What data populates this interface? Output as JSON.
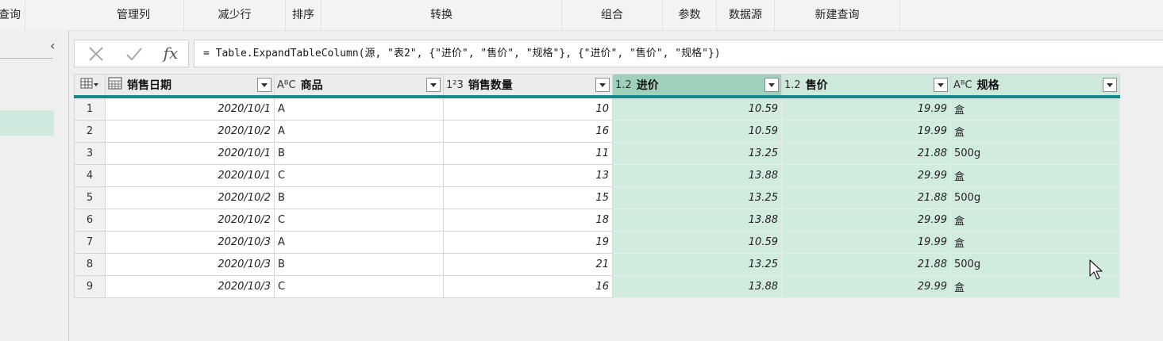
{
  "ribbon": {
    "groups": [
      "查询",
      "管理列",
      "减少行",
      "排序",
      "转换",
      "组合",
      "参数",
      "数据源",
      "新建查询"
    ]
  },
  "formula_bar": {
    "cancel_icon": "close-icon",
    "commit_icon": "check-icon",
    "fx_label": "fx",
    "formula": "= Table.ExpandTableColumn(源, \"表2\", {\"进价\", \"售价\", \"规格\"}, {\"进价\", \"售价\", \"规格\"})"
  },
  "table": {
    "columns": [
      {
        "type_icon": "calendar-icon",
        "name": "销售日期"
      },
      {
        "type_icon": "AᴮC",
        "name": "商品"
      },
      {
        "type_icon": "1²3",
        "name": "销售数量"
      },
      {
        "type_icon": "1.2",
        "name": "进价"
      },
      {
        "type_icon": "1.2",
        "name": "售价"
      },
      {
        "type_icon": "AᴮC",
        "name": "规格"
      }
    ],
    "rows": [
      {
        "n": "1",
        "date": "2020/10/1",
        "item": "A",
        "qty": "10",
        "cost": "10.59",
        "price": "19.99",
        "spec": "盒"
      },
      {
        "n": "2",
        "date": "2020/10/2",
        "item": "A",
        "qty": "16",
        "cost": "10.59",
        "price": "19.99",
        "spec": "盒"
      },
      {
        "n": "3",
        "date": "2020/10/1",
        "item": "B",
        "qty": "11",
        "cost": "13.25",
        "price": "21.88",
        "spec": "500g"
      },
      {
        "n": "4",
        "date": "2020/10/1",
        "item": "C",
        "qty": "13",
        "cost": "13.88",
        "price": "29.99",
        "spec": "盒"
      },
      {
        "n": "5",
        "date": "2020/10/2",
        "item": "B",
        "qty": "15",
        "cost": "13.25",
        "price": "21.88",
        "spec": "500g"
      },
      {
        "n": "6",
        "date": "2020/10/2",
        "item": "C",
        "qty": "18",
        "cost": "13.88",
        "price": "29.99",
        "spec": "盒"
      },
      {
        "n": "7",
        "date": "2020/10/3",
        "item": "A",
        "qty": "19",
        "cost": "10.59",
        "price": "19.99",
        "spec": "盒"
      },
      {
        "n": "8",
        "date": "2020/10/3",
        "item": "B",
        "qty": "21",
        "cost": "13.25",
        "price": "21.88",
        "spec": "500g"
      },
      {
        "n": "9",
        "date": "2020/10/3",
        "item": "C",
        "qty": "16",
        "cost": "13.88",
        "price": "29.99",
        "spec": "盒"
      }
    ]
  },
  "colors": {
    "selected_header": "#9fd0bb",
    "selected_cells": "#d2ebdf",
    "header_underline": "#13898a"
  }
}
